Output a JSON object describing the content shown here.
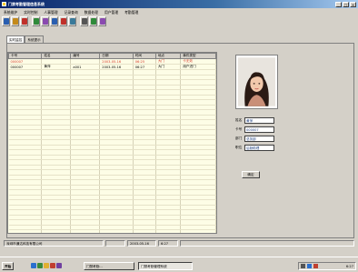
{
  "window": {
    "title": "门禁考勤管理信息系统",
    "min": "_",
    "max": "□",
    "close": "×"
  },
  "menu": [
    "系统维护",
    "实时控制",
    "人事管理",
    "记录查询",
    "数据处理",
    "用户管理",
    "考勤管理"
  ],
  "toolbar": [
    {
      "icon": "user-icon",
      "color": "#2a5fb0"
    },
    {
      "icon": "key-icon",
      "color": "#c48a1a"
    },
    {
      "icon": "door-icon",
      "color": "#c0302a"
    },
    {
      "icon": "card-icon",
      "color": "#2f8a3a"
    },
    {
      "icon": "record-icon",
      "color": "#8a4ab0"
    },
    {
      "icon": "report-icon",
      "color": "#2a5fb0"
    },
    {
      "icon": "clock-icon",
      "color": "#c0302a"
    },
    {
      "icon": "settings-icon",
      "color": "#3a7a9a"
    },
    {
      "icon": "print-icon",
      "color": "#555555"
    },
    {
      "icon": "help-icon",
      "color": "#2f8a3a"
    },
    {
      "icon": "exit-icon",
      "color": "#8a4ab0"
    }
  ],
  "tabs": [
    "实时监控",
    "系统提示"
  ],
  "grid": {
    "columns": [
      "卡号",
      "姓名",
      "编号",
      "日期",
      "时间",
      "地点",
      "事件类型"
    ],
    "rows": [
      [
        "000007",
        "",
        "",
        "2003-05-16",
        "06:25",
        "大门",
        "卡无效"
      ],
      [
        "000007",
        "黄萍",
        "a001",
        "2003-05-16",
        "06:27",
        "大门",
        "用户进门"
      ]
    ]
  },
  "person": {
    "fields": [
      {
        "label": "姓名",
        "value": "黄萍"
      },
      {
        "label": "卡号",
        "value": "000007"
      },
      {
        "label": "部门",
        "value": "总务部"
      },
      {
        "label": "职位",
        "value": "后勤助理"
      }
    ],
    "button": "确定"
  },
  "status": [
    "深圳市通达科技有限公司",
    "",
    "2003-05-16",
    "6:27",
    ""
  ],
  "taskbar": {
    "start": "开始",
    "quicklaunch": [
      {
        "icon": "ie-icon",
        "color": "#2a6fcf"
      },
      {
        "icon": "desktop-icon",
        "color": "#3a8a3a"
      },
      {
        "icon": "folder-icon",
        "color": "#e0b030"
      },
      {
        "icon": "mail-icon",
        "color": "#c04030"
      },
      {
        "icon": "media-icon",
        "color": "#7040a0"
      }
    ],
    "tasks": [
      "门禁考勤...",
      "门禁考勤管理系统"
    ],
    "tray": [
      {
        "icon": "volume-icon",
        "color": "#555555"
      },
      {
        "icon": "network-icon",
        "color": "#2a6fcf"
      },
      {
        "icon": "ime-icon",
        "color": "#c04030"
      }
    ],
    "clock": "6:27"
  },
  "colors": {
    "grid_bg": "#fdfde6",
    "invalid_row": "#d43a2a",
    "titlebar": "#0a246a"
  }
}
